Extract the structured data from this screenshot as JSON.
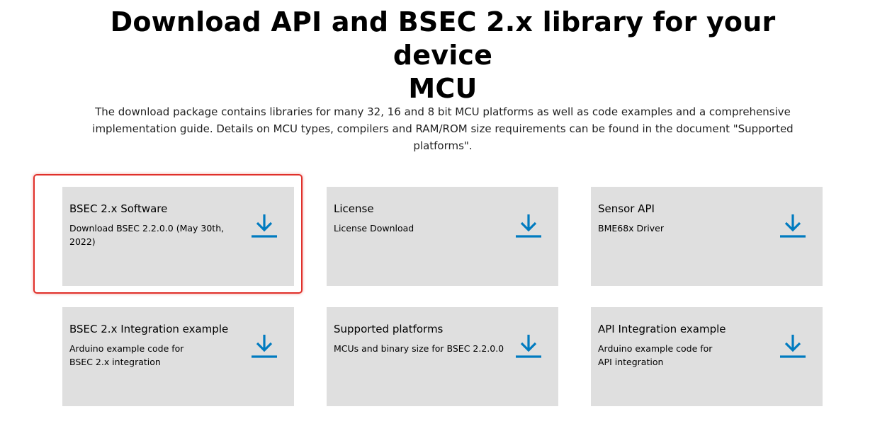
{
  "header": {
    "title_line1": "Download API and BSEC 2.x library for your device",
    "title_line2": "MCU",
    "intro": "The download package contains libraries for many 32, 16 and 8 bit MCU platforms as well as code examples and a comprehensive implementation guide. Details on MCU types, compilers and RAM/ROM size requirements can be found in the document \"Supported platforms\"."
  },
  "cards": [
    {
      "title": "BSEC 2.x Software",
      "desc_line1": "Download BSEC 2.2.0.0 (May 30th,",
      "desc_line2": "2022)",
      "icon": "download-icon",
      "highlighted": true
    },
    {
      "title": "License",
      "desc_line1": "License Download",
      "desc_line2": "",
      "icon": "download-icon"
    },
    {
      "title": "Sensor API",
      "desc_line1": "BME68x Driver",
      "desc_line2": "",
      "icon": "download-icon"
    },
    {
      "title": "BSEC 2.x Integration example",
      "desc_line1": "Arduino example code for",
      "desc_line2": "BSEC 2.x integration",
      "icon": "download-icon"
    },
    {
      "title": "Supported platforms",
      "desc_line1": "MCUs and binary size for BSEC 2.2.0.0",
      "desc_line2": "",
      "icon": "download-icon"
    },
    {
      "title": "API Integration example",
      "desc_line1": "Arduino example code for",
      "desc_line2": "API integration",
      "icon": "download-icon"
    }
  ],
  "colors": {
    "card_background": "#dfdfdf",
    "download_icon": "#007bc0",
    "highlight_border": "#e0302a"
  }
}
